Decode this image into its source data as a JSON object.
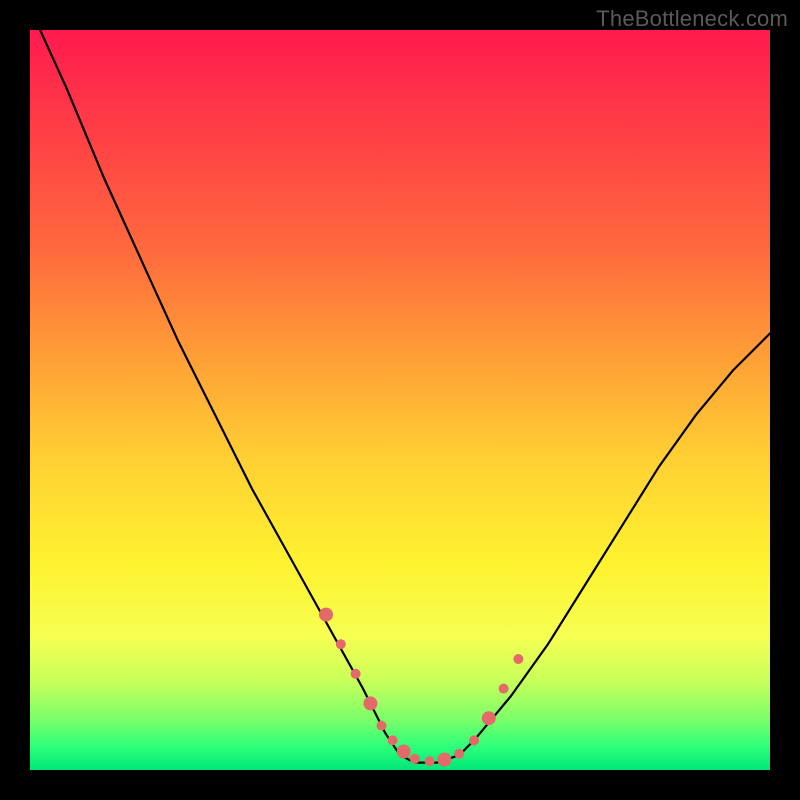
{
  "watermark": "TheBottleneck.com",
  "chart_data": {
    "type": "line",
    "title": "",
    "xlabel": "",
    "ylabel": "",
    "xlim": [
      0,
      100
    ],
    "ylim": [
      0,
      100
    ],
    "series": [
      {
        "name": "curve",
        "x": [
          0,
          5,
          10,
          15,
          20,
          25,
          30,
          35,
          40,
          45,
          48,
          50,
          52,
          55,
          58,
          60,
          65,
          70,
          75,
          80,
          85,
          90,
          95,
          100
        ],
        "y": [
          103,
          92,
          80,
          69,
          58,
          48,
          38,
          29,
          20,
          11,
          5,
          2,
          1,
          1,
          2,
          4,
          10,
          17,
          25,
          33,
          41,
          48,
          54,
          59
        ]
      }
    ],
    "markers": {
      "name": "dotted-segment",
      "color": "#e46a6a",
      "x": [
        40,
        42,
        44,
        46,
        47.5,
        49,
        50.5,
        52,
        54,
        56,
        58,
        60,
        62,
        64,
        66
      ],
      "y": [
        21,
        17,
        13,
        9,
        6,
        4,
        2.5,
        1.5,
        1.2,
        1.4,
        2.2,
        4,
        7,
        11,
        15
      ]
    }
  }
}
